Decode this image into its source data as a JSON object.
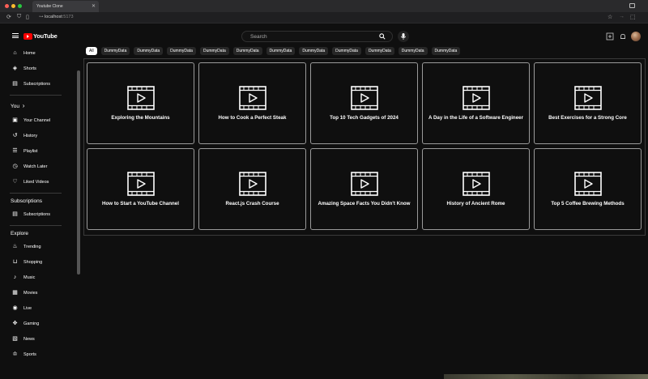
{
  "browser": {
    "tab_title": "Youtube Clone",
    "url_host": "localhost",
    "url_port": ":5173"
  },
  "brand": {
    "logo_text": "YouTube"
  },
  "search": {
    "placeholder": "Search"
  },
  "sidebar": {
    "main": [
      {
        "label": "Home",
        "icon": "home-icon"
      },
      {
        "label": "Shorts",
        "icon": "shorts-icon"
      },
      {
        "label": "Subscriptions",
        "icon": "subscriptions-icon"
      }
    ],
    "you_heading": "You",
    "you_items": [
      {
        "label": "Your Channel",
        "icon": "channel-icon"
      },
      {
        "label": "History",
        "icon": "history-icon"
      },
      {
        "label": "Playlist",
        "icon": "playlist-icon"
      },
      {
        "label": "Watch Later",
        "icon": "clock-icon"
      },
      {
        "label": "Liked Videos",
        "icon": "thumbs-up-icon"
      }
    ],
    "subscriptions_heading": "Subscriptions",
    "subscriptions_items": [
      {
        "label": "Subscriptions",
        "icon": "subscriptions-icon"
      }
    ],
    "explore_heading": "Explore",
    "explore_items": [
      {
        "label": "Trending",
        "icon": "flame-icon"
      },
      {
        "label": "Shopping",
        "icon": "shopping-bag-icon"
      },
      {
        "label": "Music",
        "icon": "music-note-icon"
      },
      {
        "label": "Movies",
        "icon": "film-icon"
      },
      {
        "label": "Live",
        "icon": "live-icon"
      },
      {
        "label": "Gaming",
        "icon": "gamepad-icon"
      },
      {
        "label": "News",
        "icon": "news-icon"
      },
      {
        "label": "Sports",
        "icon": "trophy-icon"
      }
    ]
  },
  "chips": [
    "All",
    "DummyData",
    "DummyData",
    "DummyData",
    "DummyData",
    "DummyData",
    "DummyData",
    "DummyData",
    "DummyData",
    "DummyData",
    "DummyData",
    "DummyData"
  ],
  "videos": [
    {
      "title": "Exploring the Mountains"
    },
    {
      "title": "How to Cook a Perfect Steak"
    },
    {
      "title": "Top 10 Tech Gadgets of 2024"
    },
    {
      "title": "A Day in the Life of a Software Engineer"
    },
    {
      "title": "Best Exercises for a Strong Core"
    },
    {
      "title": "How to Start a YouTube Channel"
    },
    {
      "title": "React.js Crash Course"
    },
    {
      "title": "Amazing Space Facts You Didn't Know"
    },
    {
      "title": "History of Ancient Rome"
    },
    {
      "title": "Top 5 Coffee Brewing Methods"
    }
  ],
  "colors": {
    "background": "#0f0f0f",
    "brand_red": "#ff0000",
    "card_border": "#9a9a9a"
  }
}
